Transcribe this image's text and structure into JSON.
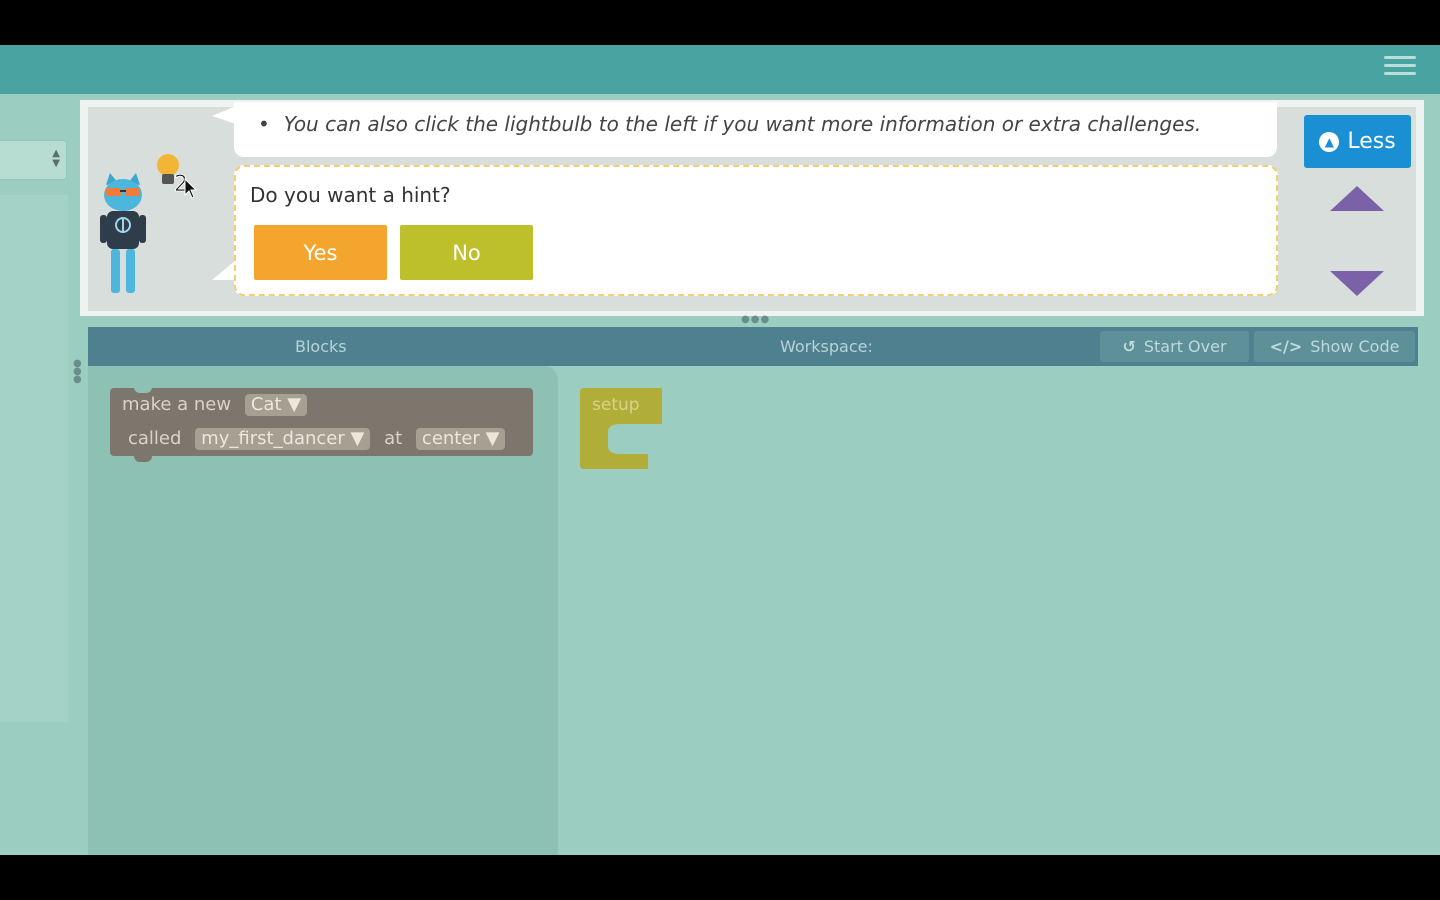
{
  "instructions": {
    "tip_text": "You can also click the lightbulb to the left if you want more information or extra challenges.",
    "hint_question": "Do you want a hint?",
    "yes_label": "Yes",
    "no_label": "No",
    "hint_count": "2",
    "less_label": "Less"
  },
  "toolbar": {
    "blocks_label": "Blocks",
    "workspace_label": "Workspace:",
    "start_over_label": "Start Over",
    "show_code_label": "Show Code"
  },
  "blocks": {
    "make_new": {
      "prefix": "make a new",
      "sprite_value": "Cat",
      "called_label": "called",
      "name_value": "my_first_dancer",
      "at_label": "at",
      "location_value": "center"
    }
  },
  "workspace": {
    "setup_label": "setup"
  },
  "colors": {
    "topbar": "#49a3a1",
    "yes_button": "#f4a52e",
    "no_button": "#bdc02b",
    "less_button": "#1a8fd4",
    "arrows": "#7b61a7",
    "setup_block": "#b0ad38"
  }
}
